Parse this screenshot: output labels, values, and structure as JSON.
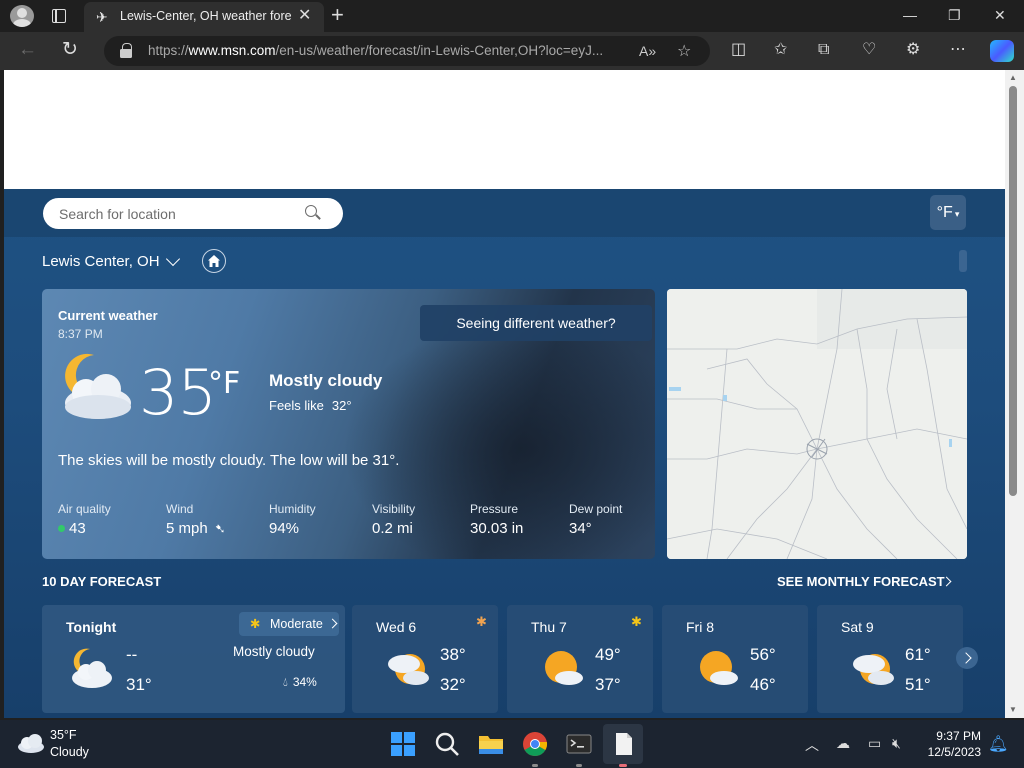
{
  "browser": {
    "tab_title": "Lewis-Center, OH weather forecast",
    "url_prefix": "https://",
    "url_host": "www.msn.com",
    "url_path": "/en-us/weather/forecast/in-Lewis-Center,OH?loc=eyJ..."
  },
  "search": {
    "placeholder": "Search for location"
  },
  "unit_toggle": "°F",
  "location": "Lewis Center, OH",
  "current": {
    "title": "Current weather",
    "time": "8:37 PM",
    "temp": "35",
    "unit": "°F",
    "condition": "Mostly cloudy",
    "feels_label": "Feels like",
    "feels_value": "32°",
    "summary": "The skies will be mostly cloudy. The low will be 31°.",
    "different_button": "Seeing different weather?",
    "stats": [
      {
        "label": "Air quality",
        "value": "43"
      },
      {
        "label": "Wind",
        "value": "5 mph"
      },
      {
        "label": "Humidity",
        "value": "94%"
      },
      {
        "label": "Visibility",
        "value": "0.2 mi"
      },
      {
        "label": "Pressure",
        "value": "30.03 in"
      },
      {
        "label": "Dew point",
        "value": "34°"
      }
    ]
  },
  "forecast": {
    "title": "10 DAY FORECAST",
    "monthly_link": "SEE MONTHLY FORECAST",
    "days": [
      {
        "day": "Tonight",
        "hi": "--",
        "lo": "31°",
        "aq": "Moderate",
        "condition": "Mostly cloudy",
        "rain": "34%"
      },
      {
        "day": "Wed 6",
        "hi": "38°",
        "lo": "32°"
      },
      {
        "day": "Thu 7",
        "hi": "49°",
        "lo": "37°"
      },
      {
        "day": "Fri 8",
        "hi": "56°",
        "lo": "46°"
      },
      {
        "day": "Sat 9",
        "hi": "61°",
        "lo": "51°"
      }
    ]
  },
  "taskbar": {
    "weather_temp": "35°F",
    "weather_cond": "Cloudy",
    "time": "9:37 PM",
    "date": "12/5/2023"
  },
  "colors": {
    "accent": "#1f5283",
    "aq_good": "#32c96a",
    "sun": "#f5a623"
  }
}
